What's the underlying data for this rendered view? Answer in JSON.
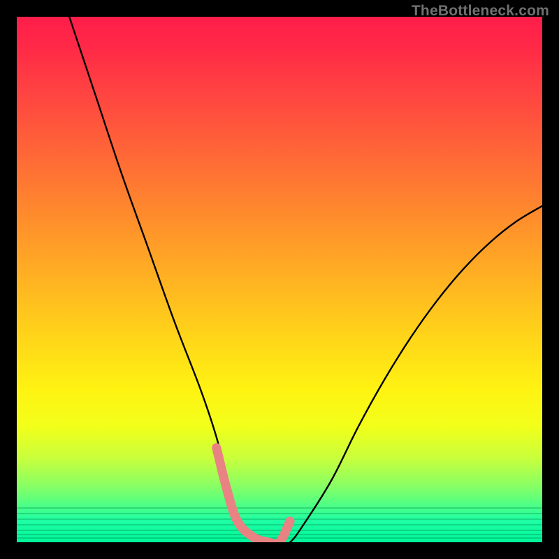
{
  "watermark": "TheBottleneck.com",
  "chart_data": {
    "type": "line",
    "title": "",
    "xlabel": "",
    "ylabel": "",
    "xlim": [
      0,
      100
    ],
    "ylim": [
      0,
      100
    ],
    "series": [
      {
        "name": "curve",
        "x": [
          10,
          15,
          20,
          25,
          30,
          35,
          38,
          40,
          42,
          45,
          48,
          50,
          52,
          55,
          60,
          65,
          70,
          75,
          80,
          85,
          90,
          95,
          100
        ],
        "values": [
          100,
          85,
          70,
          56,
          42,
          29,
          20,
          12,
          5,
          1,
          0,
          0,
          0,
          4,
          12,
          22,
          31,
          39,
          46,
          52,
          57,
          61,
          64
        ]
      },
      {
        "name": "highlight-segment",
        "x": [
          38,
          40,
          42,
          45,
          48,
          50,
          52
        ],
        "values": [
          18,
          10,
          4,
          1,
          0,
          0,
          4
        ]
      }
    ],
    "colors": {
      "curve": "#000000",
      "highlight": "#e98282",
      "gradient_top": "#ff1d4a",
      "gradient_bottom": "#00f59a",
      "frame": "#000000"
    }
  }
}
